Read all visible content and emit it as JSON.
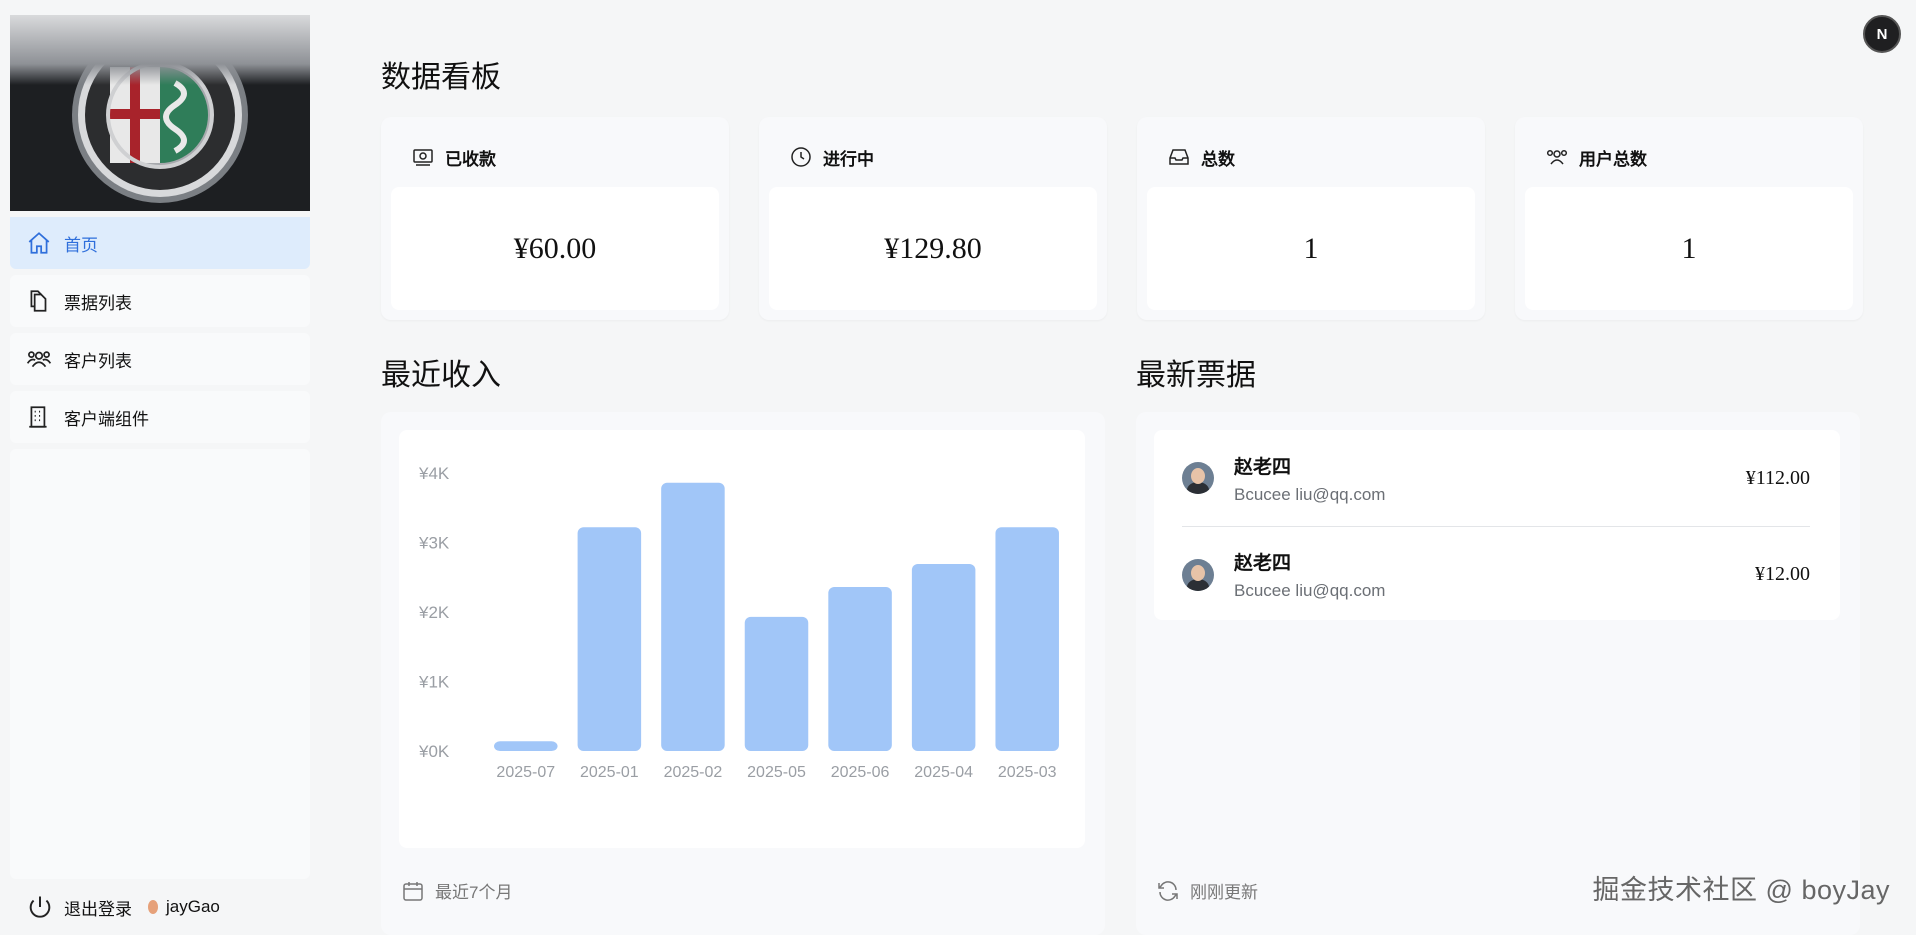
{
  "sidebar": {
    "items": [
      {
        "label": "首页",
        "icon": "home-icon"
      },
      {
        "label": "票据列表",
        "icon": "documents-icon"
      },
      {
        "label": "客户列表",
        "icon": "users-icon"
      },
      {
        "label": "客户端组件",
        "icon": "building-icon"
      }
    ],
    "footer": {
      "logout_label": "退出登录",
      "username": "jayGao"
    }
  },
  "topbar": {
    "avatar_letter": "N"
  },
  "page": {
    "title": "数据看板"
  },
  "cards": [
    {
      "title": "已收款",
      "value": "¥60.00",
      "icon": "banknote-icon"
    },
    {
      "title": "进行中",
      "value": "¥129.80",
      "icon": "clock-icon"
    },
    {
      "title": "总数",
      "value": "1",
      "icon": "inbox-icon"
    },
    {
      "title": "用户总数",
      "value": "1",
      "icon": "user-group-icon"
    }
  ],
  "revenue": {
    "title": "最近收入",
    "footer": "最近7个月"
  },
  "invoices": {
    "title": "最新票据",
    "footer": "刚刚更新",
    "rows": [
      {
        "name": "赵老四",
        "email": "Bcucee liu@qq.com",
        "amount": "¥112.00"
      },
      {
        "name": "赵老四",
        "email": "Bcucee liu@qq.com",
        "amount": "¥12.00"
      }
    ]
  },
  "watermark": "掘金技术社区 @ boyJay",
  "colors": {
    "accent": "#2f6fdb",
    "bar": "#a1c6f8",
    "active_bg": "#deecfc"
  },
  "chart_data": {
    "type": "bar",
    "categories": [
      "2025-07",
      "2025-01",
      "2025-02",
      "2025-05",
      "2025-06",
      "2025-04",
      "2025-03"
    ],
    "values": [
      140,
      3220,
      3860,
      1930,
      2360,
      2690,
      3220
    ],
    "yticks": [
      "¥0K",
      "¥1K",
      "¥2K",
      "¥3K",
      "¥4K"
    ],
    "ylim": [
      0,
      4000
    ],
    "grid": false,
    "color": "#a1c6f8"
  }
}
